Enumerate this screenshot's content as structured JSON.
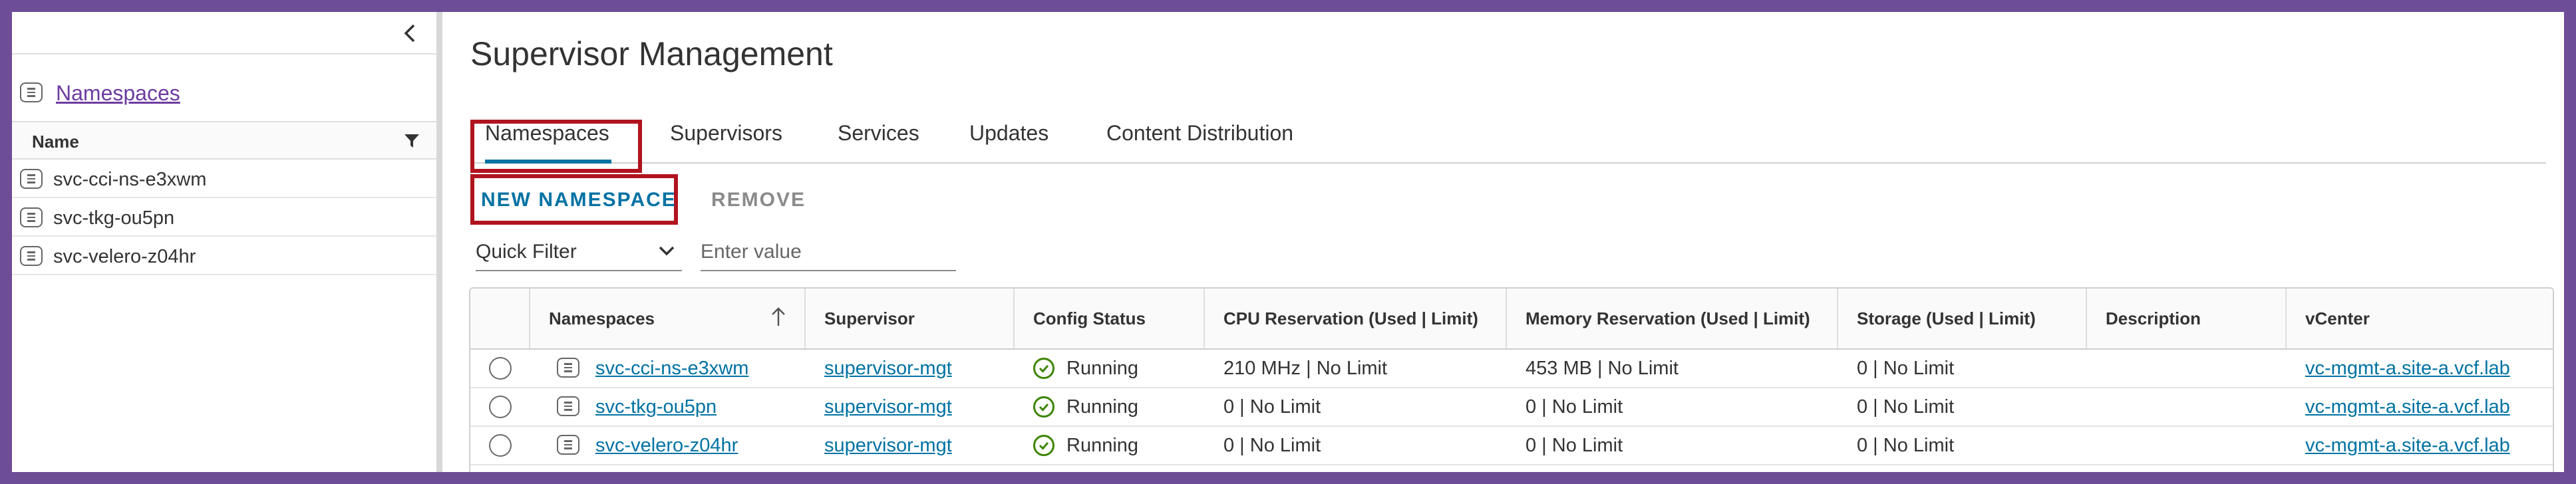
{
  "sidebar": {
    "title": "Namespaces",
    "column_header": "Name",
    "items": [
      {
        "label": "svc-cci-ns-e3xwm"
      },
      {
        "label": "svc-tkg-ou5pn"
      },
      {
        "label": "svc-velero-z04hr"
      }
    ]
  },
  "page": {
    "title": "Supervisor Management"
  },
  "tabs": [
    {
      "label": "Namespaces",
      "active": true
    },
    {
      "label": "Supervisors",
      "active": false
    },
    {
      "label": "Services",
      "active": false
    },
    {
      "label": "Updates",
      "active": false
    },
    {
      "label": "Content Distribution",
      "active": false
    }
  ],
  "actions": {
    "new_namespace": "NEW NAMESPACE",
    "remove": "REMOVE"
  },
  "filter": {
    "selected": "Quick Filter",
    "placeholder": "Enter value"
  },
  "grid": {
    "columns": [
      "Namespaces",
      "Supervisor",
      "Config Status",
      "CPU Reservation (Used | Limit)",
      "Memory Reservation (Used | Limit)",
      "Storage (Used | Limit)",
      "Description",
      "vCenter"
    ],
    "rows": [
      {
        "namespace": "svc-cci-ns-e3xwm",
        "supervisor": "supervisor-mgt",
        "status": "Running",
        "cpu": "210 MHz | No Limit",
        "memory": "453 MB | No Limit",
        "storage": "0 | No Limit",
        "description": "",
        "vcenter": "vc-mgmt-a.site-a.vcf.lab"
      },
      {
        "namespace": "svc-tkg-ou5pn",
        "supervisor": "supervisor-mgt",
        "status": "Running",
        "cpu": "0 | No Limit",
        "memory": "0 | No Limit",
        "storage": "0 | No Limit",
        "description": "",
        "vcenter": "vc-mgmt-a.site-a.vcf.lab"
      },
      {
        "namespace": "svc-velero-z04hr",
        "supervisor": "supervisor-mgt",
        "status": "Running",
        "cpu": "0 | No Limit",
        "memory": "0 | No Limit",
        "storage": "0 | No Limit",
        "description": "",
        "vcenter": "vc-mgmt-a.site-a.vcf.lab"
      }
    ]
  },
  "colors": {
    "frame_border": "#6e4d97",
    "accent": "#0072a3",
    "highlight_box": "#b0131f",
    "status_ok": "#3c8500",
    "sidebar_link": "#6d3ba0"
  },
  "icons": {
    "collapse": "chevron-left-icon",
    "filter": "filter-icon",
    "sort": "arrow-up-icon",
    "namespace": "namespace-icon",
    "status": "check-circle-icon",
    "dropdown": "chevron-down-icon"
  }
}
